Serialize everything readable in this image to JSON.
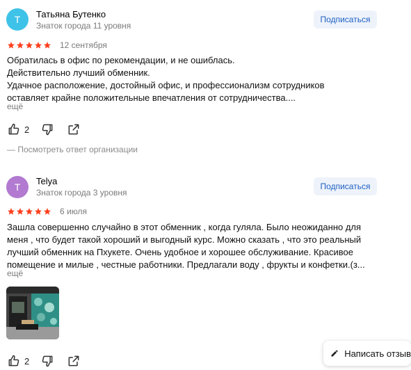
{
  "reviews": [
    {
      "avatar_letter": "T",
      "avatar_color": "#3ec2e8",
      "name": "Татьяна Бутенко",
      "level": "Знаток города 11 уровня",
      "subscribe_label": "Подписаться",
      "rating": 5,
      "date": "12 сентября",
      "text": "Обратилась в офис по рекомендации, и не ошиблась.\nДействительно лучший обменник.\nУдачное расположение, достойный офис, и профессионализм сотрудников оставляет крайне положительные впечатления от сотрудничества....",
      "more_label": "ещё",
      "likes": "2",
      "org_reply_label": "— Посмотреть ответ организации"
    },
    {
      "avatar_letter": "T",
      "avatar_color": "#b27ad0",
      "name": "Telya",
      "level": "Знаток города 3 уровня",
      "subscribe_label": "Подписаться",
      "rating": 5,
      "date": "6 июля",
      "text": "Зашла совершенно случайно в этот обменник , когда гуляла. Было неожиданно для меня , что будет такой хороший и выгодный курс. Можно сказать , что это реальный лучший обменник на Пхукете. Очень удобное и хорошее обслуживание. Красивое помещение и милые , честные работники. Предлагали воду , фрукты и конфетки.(з...",
      "more_label": "ещё",
      "likes": "2"
    }
  ],
  "write_review_label": "Написать отзыв",
  "colors": {
    "star": "#fc3f1d",
    "accent": "#1d5fc2"
  }
}
